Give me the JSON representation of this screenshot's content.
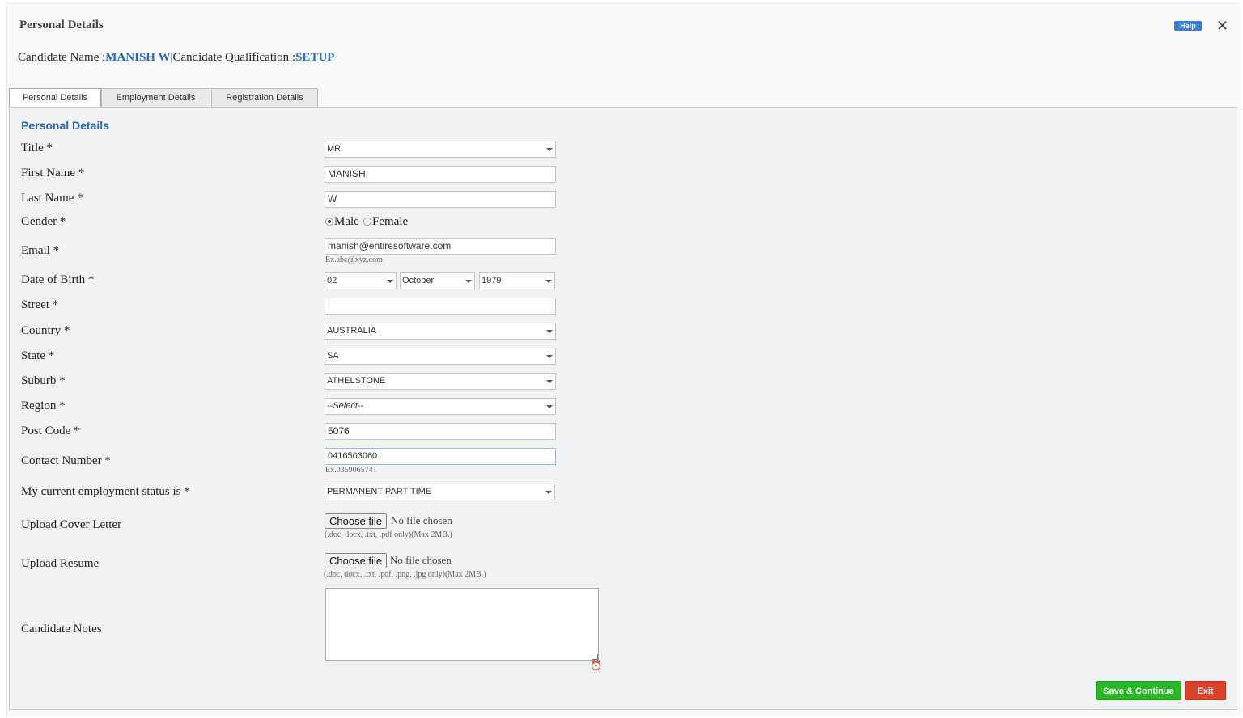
{
  "dialog": {
    "title": "Personal Details",
    "help_label": "Help",
    "close_icon": "close-icon"
  },
  "candidate": {
    "name_label": "Candidate Name :",
    "name": "MANISH W",
    "separator": "|",
    "qualification_label": "Candidate Qualification :",
    "qualification": "SETUP"
  },
  "tabs": [
    {
      "label": "Personal Details",
      "active": true
    },
    {
      "label": "Employment Details",
      "active": false
    },
    {
      "label": "Registration Details",
      "active": false
    }
  ],
  "form": {
    "section_title": "Personal Details",
    "title": {
      "label": "Title *",
      "value": "MR"
    },
    "first_name": {
      "label": "First Name *",
      "value": "MANISH"
    },
    "last_name": {
      "label": "Last Name *",
      "value": "W"
    },
    "gender": {
      "label": "Gender *",
      "options": [
        "Male",
        "Female"
      ],
      "selected": "Male"
    },
    "email": {
      "label": "Email *",
      "value": "manish@entiresoftware.com",
      "hint": "Ex.abc@xyz.com"
    },
    "dob": {
      "label": "Date of Birth *",
      "day": "02",
      "month": "October",
      "year": "1979"
    },
    "street": {
      "label": "Street *",
      "value": ""
    },
    "country": {
      "label": "Country *",
      "value": "AUSTRALIA"
    },
    "state": {
      "label": "State *",
      "value": "SA"
    },
    "suburb": {
      "label": "Suburb *",
      "value": "ATHELSTONE"
    },
    "region": {
      "label": "Region *",
      "value": "--Select--"
    },
    "post_code": {
      "label": "Post Code *",
      "value": "5076"
    },
    "contact": {
      "label": "Contact Number *",
      "value": "0416503060",
      "hint": "Ex.0359065741"
    },
    "employment_status": {
      "label": "My current employment status is *",
      "value": "PERMANENT PART TIME"
    },
    "cover_letter": {
      "label": "Upload Cover Letter",
      "button": "Choose file",
      "status": "No file chosen",
      "hint": "(.doc, docx, .txt, .pdf only)(Max 2MB.)"
    },
    "resume": {
      "label": "Upload Resume",
      "button": "Choose file",
      "status": "No file chosen",
      "hint": "(.doc, docx, .txt, .pdf, .png, .jpg only)(Max 2MB.)"
    },
    "notes": {
      "label": "Candidate Notes",
      "value": ""
    }
  },
  "actions": {
    "save_label": "Save & Continue",
    "exit_label": "Exit"
  },
  "colors": {
    "accent": "#2a6bb8",
    "save": "#2db52a",
    "exit": "#d9412c",
    "help": "#3c7ed8"
  }
}
